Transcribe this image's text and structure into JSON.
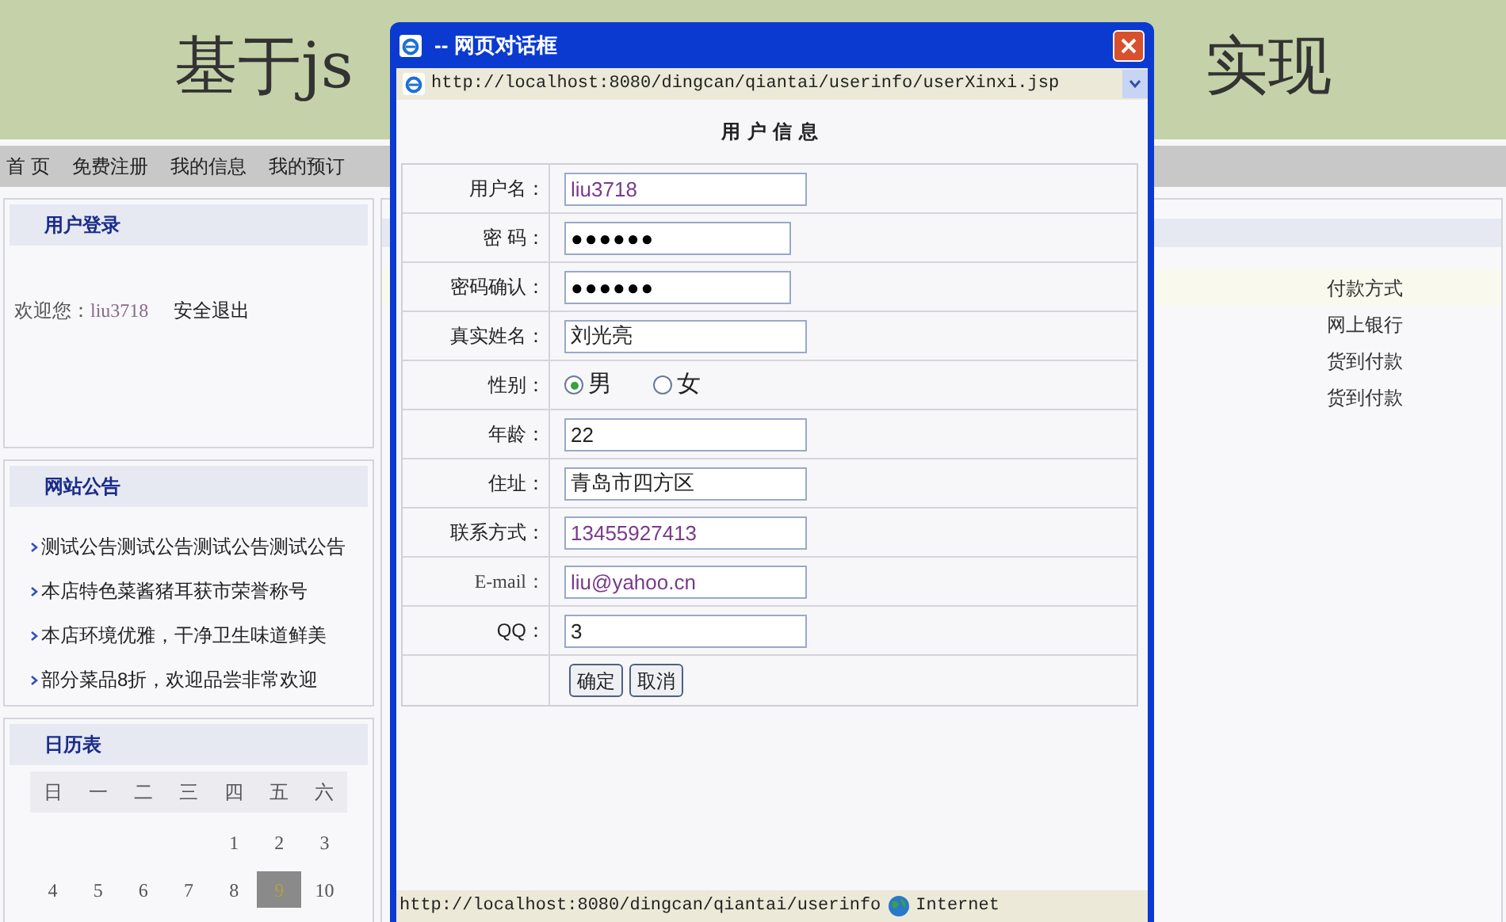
{
  "banner": {
    "title_left": "基于js",
    "title_right": "实现"
  },
  "nav": [
    "首 页",
    "免费注册",
    "我的信息",
    "我的预订"
  ],
  "login_panel": {
    "title": "用户登录",
    "welcome": "欢迎您：",
    "username": "liu3718",
    "logout": "安全退出"
  },
  "notice_panel": {
    "title": "网站公告",
    "items": [
      "测试公告测试公告测试公告测试公告",
      "本店特色菜酱猪耳获市荣誉称号",
      "本店环境优雅，干净卫生味道鲜美",
      "部分菜品8折，欢迎品尝非常欢迎"
    ]
  },
  "calendar": {
    "title": "日历表",
    "weekdays": [
      "日",
      "一",
      "二",
      "三",
      "四",
      "五",
      "六"
    ],
    "weeks": [
      [
        {
          "day": "1",
          "selected": false
        },
        {
          "day": "2",
          "selected": false
        },
        {
          "day": "3",
          "selected": false
        }
      ],
      [
        {
          "day": "4",
          "selected": false
        },
        {
          "day": "5",
          "selected": false
        },
        {
          "day": "6",
          "selected": false
        },
        {
          "day": "7",
          "selected": false
        },
        {
          "day": "8",
          "selected": false
        },
        {
          "day": "9",
          "selected": true
        },
        {
          "day": "10",
          "selected": false
        }
      ]
    ]
  },
  "payment_list": [
    "付款方式",
    "网上银行",
    "货到付款",
    "货到付款"
  ],
  "dialog": {
    "title": "-- 网页对话框",
    "address": "http://localhost:8080/dingcan/qiantai/userinfo/userXinxi.jsp",
    "heading": "用 户 信 息",
    "fields": [
      {
        "kind": "text",
        "label": "用户名：",
        "value": "liu3718",
        "colored": true
      },
      {
        "kind": "password",
        "label": "密 码：",
        "value": "●●●●●●"
      },
      {
        "kind": "password",
        "label": "密码确认：",
        "value": "●●●●●●"
      },
      {
        "kind": "text",
        "label": "真实姓名：",
        "value": "刘光亮",
        "colored": false
      },
      {
        "kind": "radio",
        "label": "性别：",
        "options": [
          {
            "label": "男",
            "selected": true
          },
          {
            "label": "女",
            "selected": false
          }
        ]
      },
      {
        "kind": "text",
        "label": "年龄：",
        "value": "22",
        "colored": false
      },
      {
        "kind": "text",
        "label": "住址：",
        "value": "青岛市四方区",
        "colored": false
      },
      {
        "kind": "text",
        "label": "联系方式：",
        "value": "13455927413",
        "colored": true
      },
      {
        "kind": "text",
        "label": "E-mail：",
        "value": "liu@yahoo.cn",
        "colored": true
      },
      {
        "kind": "text",
        "label": "QQ：",
        "value": "3",
        "colored": false
      }
    ],
    "buttons": [
      "确定",
      "取消"
    ],
    "status_url": "http://localhost:8080/dingcan/qiantai/userinfo",
    "zone": "Internet"
  }
}
